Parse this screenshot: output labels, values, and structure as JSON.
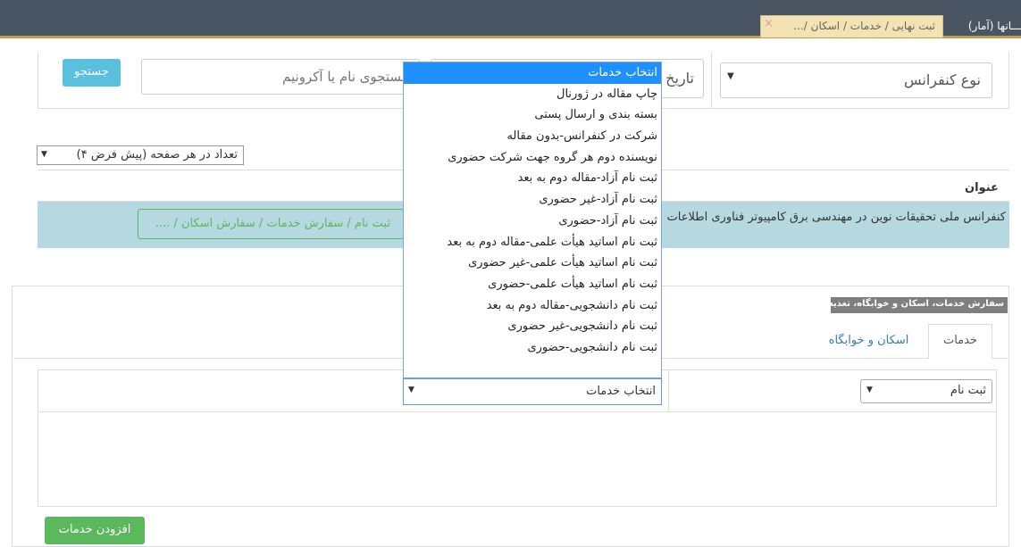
{
  "topbar": {
    "active_tab": "ثبت نهایی / خدمات / اسکان /...",
    "close": "×",
    "other_tab": "ـــانها (آمار)"
  },
  "filters": {
    "conference_type": "نوع کنفرانس",
    "date_label": "تاریخ",
    "search_placeholder": "جستجوی نام یا آکرونیم",
    "search_button": "جستجو"
  },
  "per_page": {
    "label": "تعداد در هر صفحه (پیش فرض ۴)",
    "arrow": "▼"
  },
  "table": {
    "header_title": "عنوان",
    "rows": [
      {
        "title": "کنفرانس ملی تحقیقات نوین در مهندسی برق کامپیوتر فناوری اطلاعات",
        "action": "ثبت نام / سفارش خدمات / سفارش اسکان / ...."
      }
    ]
  },
  "order": {
    "panel_label": "سفارش خدمات، اسکان و خوابگاه، تغذیه:",
    "tabs": [
      "خدمات",
      "اسکان و خوابگاه"
    ],
    "reg_select": "ثبت نام",
    "service_select": "انتخاب خدمات",
    "add_button": "افزودن خدمات"
  },
  "dropdown": {
    "options": [
      "انتخاب خدمات",
      "چاپ مقاله در ژورنال",
      "بسته بندی و ارسال پستی",
      "شرکت در کنفرانس-بدون مقاله",
      "نویسنده دوم هر گروه جهت شرکت حضوری",
      "ثبت نام آزاد-مقاله دوم به بعد",
      "ثبت نام آزاد-غیر حضوری",
      "ثبت نام آزاد-حضوری",
      "ثبت نام اساتید هیأت علمی-مقاله دوم به بعد",
      "ثبت نام اساتید هیأت علمی-غیر حضوری",
      "ثبت نام اساتید هیأت علمی-حضوری",
      "ثبت نام دانشجویی-مقاله دوم به بعد",
      "ثبت نام دانشجویی-غیر حضوری",
      "ثبت نام دانشجویی-حضوری"
    ],
    "selected_index": 0
  },
  "icons": {
    "select_arrow": "▼"
  },
  "colors": {
    "topbar": "#4a5563",
    "accent_line": "#c59a4b",
    "info_button": "#5bc0de",
    "success": "#5cb85c",
    "row_highlight": "#b6d8e0",
    "dropdown_selected": "#1e90ff"
  }
}
